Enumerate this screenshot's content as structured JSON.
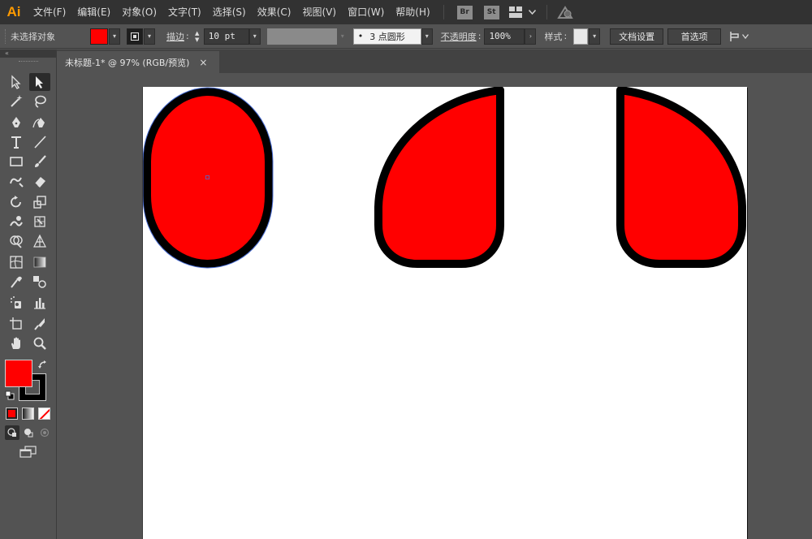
{
  "app": {
    "logo": "Ai"
  },
  "menu": [
    {
      "id": "file",
      "label": "文件(F)"
    },
    {
      "id": "edit",
      "label": "编辑(E)"
    },
    {
      "id": "object",
      "label": "对象(O)"
    },
    {
      "id": "type",
      "label": "文字(T)"
    },
    {
      "id": "select",
      "label": "选择(S)"
    },
    {
      "id": "effect",
      "label": "效果(C)"
    },
    {
      "id": "view",
      "label": "视图(V)"
    },
    {
      "id": "window",
      "label": "窗口(W)"
    },
    {
      "id": "help",
      "label": "帮助(H)"
    }
  ],
  "ext_buttons": {
    "bridge": "Br",
    "stock": "St"
  },
  "control": {
    "selection_status": "未选择对象",
    "fill_color": "#ff0000",
    "stroke_label": "描边",
    "stroke_colon": ":",
    "stroke_weight": "10 pt",
    "brush_profile": "3 点圆形",
    "brush_dot": "•",
    "opacity_label": "不透明度",
    "opacity_colon": ":",
    "opacity_value": "100%",
    "style_label": "样式",
    "style_colon": ":",
    "doc_setup_button": "文档设置",
    "preferences_button": "首选项"
  },
  "toolbar": {
    "collapse": "«"
  },
  "tabs": [
    {
      "title": "未标题-1* @ 97% (RGB/预览)",
      "close": "×"
    }
  ],
  "colors": {
    "fill": "#ff0000",
    "stroke": "#000000",
    "accent": "#ff9a00",
    "selection": "#4b6fd6"
  },
  "artwork": {
    "shapes": [
      {
        "name": "pill-shape",
        "fill": "#ff0000",
        "stroke": "#000000",
        "selected": true
      },
      {
        "name": "left-drop-shape",
        "fill": "#ff0000",
        "stroke": "#000000",
        "selected": false
      },
      {
        "name": "right-drop-shape",
        "fill": "#ff0000",
        "stroke": "#000000",
        "selected": false
      }
    ]
  }
}
